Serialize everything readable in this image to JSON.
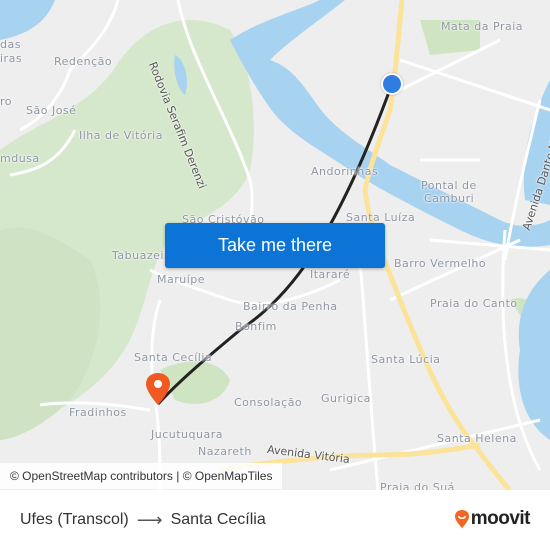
{
  "map": {
    "neighborhood_labels": [
      {
        "id": "mata-da-praia",
        "text": "Mata da Praia"
      },
      {
        "id": "das",
        "text": "das"
      },
      {
        "id": "iras",
        "text": "iras"
      },
      {
        "id": "redencao",
        "text": "Redenção"
      },
      {
        "id": "ro",
        "text": "ro"
      },
      {
        "id": "sao-jose",
        "text": "São José"
      },
      {
        "id": "ilha-de-vitoria",
        "text": "Ilha de Vitória"
      },
      {
        "id": "mdusa",
        "text": "mdusa"
      },
      {
        "id": "andorinhas",
        "text": "Andorinhas"
      },
      {
        "id": "pontal-de-camburi-1",
        "text": "Pontal de"
      },
      {
        "id": "pontal-de-camburi-2",
        "text": "Camburi"
      },
      {
        "id": "sao-cristovao",
        "text": "São Cristóvão"
      },
      {
        "id": "santa-luiza",
        "text": "Santa Luíza"
      },
      {
        "id": "tabuazeiro",
        "text": "Tabuazeiro"
      },
      {
        "id": "barro-vermelho",
        "text": "Barro Vermelho"
      },
      {
        "id": "maruipe",
        "text": "Maruípe"
      },
      {
        "id": "itarare",
        "text": "Itararé"
      },
      {
        "id": "bairro-da-penha",
        "text": "Bairro da Penha"
      },
      {
        "id": "praia-do-canto",
        "text": "Praia do Canto"
      },
      {
        "id": "bonfim",
        "text": "Bonfim"
      },
      {
        "id": "santa-cecilia",
        "text": "Santa Cecília"
      },
      {
        "id": "santa-lucia",
        "text": "Santa Lúcia"
      },
      {
        "id": "fradinhos",
        "text": "Fradinhos"
      },
      {
        "id": "gurigica",
        "text": "Gurigica"
      },
      {
        "id": "consolacao",
        "text": "Consolação"
      },
      {
        "id": "jucutuquara",
        "text": "Jucutuquara"
      },
      {
        "id": "santa-helena",
        "text": "Santa Helena"
      },
      {
        "id": "nazareth",
        "text": "Nazareth"
      },
      {
        "id": "praia-do-sua",
        "text": "Praia do Suá"
      }
    ],
    "road_labels": [
      {
        "id": "rodovia-serafim-derenzi",
        "text": "Rodovia Serafim Derenzi"
      },
      {
        "id": "avenida-dante-michelini",
        "text": "Avenida Dante Michelini"
      },
      {
        "id": "avenida-vitoria",
        "text": "Avenida Vitória"
      }
    ],
    "colors": {
      "origin_marker": "#2f7de1",
      "destination_marker": "#f05a22",
      "route_line": "#222222",
      "water": "#a8d3f0",
      "park": "#cfe5c2",
      "major_road": "#fbe39a"
    }
  },
  "cta": {
    "label": "Take me there"
  },
  "attribution": {
    "text": "© OpenStreetMap contributors | © OpenMapTiles"
  },
  "footer": {
    "origin": "Ufes (Transcol)",
    "arrow": "⟶",
    "destination": "Santa Cecília",
    "brand": "moovit",
    "brand_color": "#f26522"
  }
}
